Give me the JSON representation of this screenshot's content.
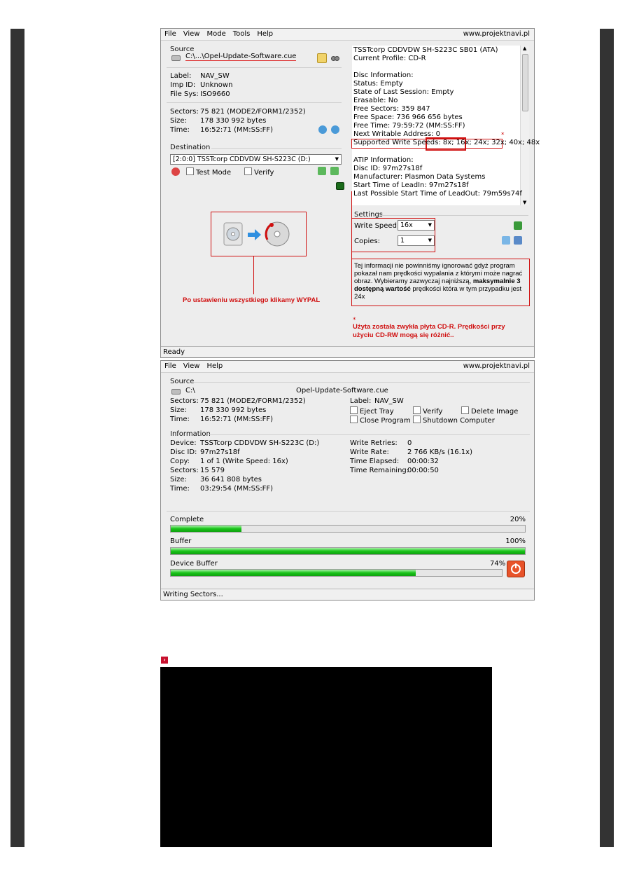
{
  "win1": {
    "menu": [
      "File",
      "View",
      "Mode",
      "Tools",
      "Help"
    ],
    "url": "www.projektnavi.pl",
    "source_title": "Source",
    "source_path": "C:\\...\\Opel-Update-Software.cue",
    "info_rows": [
      {
        "k": "Label:",
        "v": "NAV_SW"
      },
      {
        "k": "Imp ID:",
        "v": "Unknown"
      },
      {
        "k": "File Sys:",
        "v": "ISO9660"
      }
    ],
    "sector_rows": [
      {
        "k": "Sectors:",
        "v": "75 821 (MODE2/FORM1/2352)"
      },
      {
        "k": "Size:",
        "v": "178 330 992 bytes"
      },
      {
        "k": "Time:",
        "v": "16:52:71 (MM:SS:FF)"
      }
    ],
    "destination_title": "Destination",
    "destination_drive": "[2:0:0] TSSTcorp CDDVDW SH-S223C (D:)",
    "test_mode": "Test Mode",
    "verify": "Verify",
    "write_caption": "Po ustawieniu wszystkiego klikamy WYPAL",
    "device_lines": [
      "TSSTcorp CDDVDW SH-S223C SB01 (ATA)",
      "Current Profile: CD-R",
      "",
      "Disc Information:",
      "Status: Empty",
      "State of Last Session: Empty",
      "Erasable: No",
      "Free Sectors: 359 847",
      "Free Space: 736 966 656 bytes",
      "Free Time: 79:59:72 (MM:SS:FF)",
      "Next Writable Address: 0"
    ],
    "speeds_label": "Supported Write Speeds:",
    "speeds_a": "8x;",
    "speeds_b": "16x; 24x;",
    "speeds_c": "32x; 40x; 48x",
    "star": "*",
    "atip_lines": [
      "ATIP Information:",
      "Disc ID: 97m27s18f",
      "Manufacturer: Plasmon Data Systems",
      "Start Time of LeadIn: 97m27s18f",
      "Last Possible Start Time of LeadOut: 79m59s74f"
    ],
    "settings_title": "Settings",
    "write_speed_label": "Write Speed:",
    "write_speed_value": "16x",
    "copies_label": "Copies:",
    "copies_value": "1",
    "note_text_1": "Tej informacji nie powinniśmy ignorować gdyż program pokazał nam prędkości wypalania z którymi może nagrać obraz. Wybieramy zazwyczaj najniższą,",
    "note_bold": "maksymalnie 3 dostępną wartość",
    "note_text_2": "prędkości która w tym przypadku jest 24x",
    "footnote_star": "*",
    "footnote_1": "Użyta została zwykła płyta CD-R. Prędkości przy",
    "footnote_2": "użyciu CD-RW mogą się różnić..",
    "status": "Ready"
  },
  "win2": {
    "menu": [
      "File",
      "View",
      "Help"
    ],
    "url": "www.projektnavi.pl",
    "source_title": "Source",
    "source_drive": "C:\\",
    "source_file": "Opel-Update-Software.cue",
    "sector_rows": [
      {
        "k": "Sectors:",
        "v": "75 821 (MODE2/FORM1/2352)"
      },
      {
        "k": "Size:",
        "v": "178 330 992 bytes"
      },
      {
        "k": "Time:",
        "v": "16:52:71 (MM:SS:FF)"
      }
    ],
    "label_k": "Label:",
    "label_v": "NAV_SW",
    "options": [
      "Eject Tray",
      "Verify",
      "Delete Image",
      "Close Program",
      "Shutdown Computer"
    ],
    "information_title": "Information",
    "info_left": [
      {
        "k": "Device:",
        "v": "TSSTcorp CDDVDW SH-S223C (D:)"
      },
      {
        "k": "Disc ID:",
        "v": "97m27s18f"
      },
      {
        "k": "Copy:",
        "v": "1 of 1 (Write Speed: 16x)"
      },
      {
        "k": "Sectors:",
        "v": "15 579"
      },
      {
        "k": "Size:",
        "v": "36 641 808 bytes"
      },
      {
        "k": "Time:",
        "v": "03:29:54 (MM:SS:FF)"
      }
    ],
    "info_right": [
      {
        "k": "Write Retries:",
        "v": "0"
      },
      {
        "k": "Write Rate:",
        "v": "2 766 KB/s (16.1x)"
      },
      {
        "k": "Time Elapsed:",
        "v": "00:00:32"
      },
      {
        "k": "Time Remaining:",
        "v": "00:00:50"
      }
    ],
    "progress": [
      {
        "label": "Complete",
        "pct_text": "20%",
        "value": 0.2
      },
      {
        "label": "Buffer",
        "pct_text": "100%",
        "value": 1.0
      },
      {
        "label": "Device Buffer",
        "pct_text": "74%",
        "value": 0.74
      }
    ],
    "status": "Writing Sectors..."
  },
  "colors": {
    "annotation_red": "#d01010",
    "progress_green": "#19c419",
    "sidebar": "#333333",
    "video_bg": "#000000"
  },
  "icons": [
    "drive-icon",
    "browse-folder-icon",
    "binoculars-icon",
    "write-icon",
    "cd-disc-icon",
    "arrow-right-icon",
    "stop-icon",
    "link-arrow-icon"
  ]
}
